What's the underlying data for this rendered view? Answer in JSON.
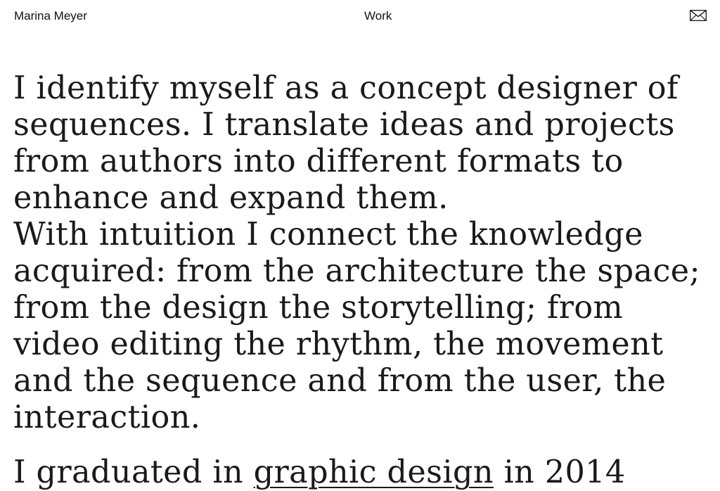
{
  "header": {
    "site_name": "Marina Meyer",
    "nav_work": "Work",
    "mail_icon": "envelope-icon"
  },
  "bio": {
    "paragraph_1": "I identify myself as a concept designer of sequences. I translate ideas and projects from authors into different formats to enhance and expand them.",
    "paragraph_2": "With intuition I connect the knowledge acquired: from the architecture the space; from the design the storytelling; from video editing the rhythm, the movement and the sequence and from the user, the interaction.",
    "paragraph_3_prefix": "I graduated in ",
    "paragraph_3_link": "graphic design",
    "paragraph_3_suffix": " in 2014"
  }
}
